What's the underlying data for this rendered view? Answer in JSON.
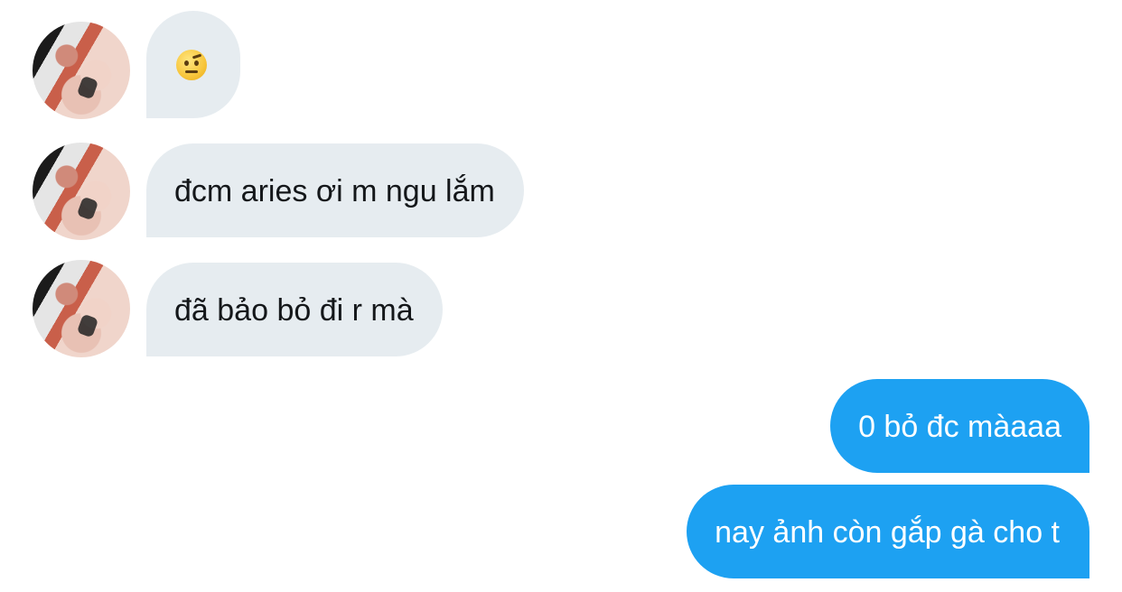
{
  "conversation": {
    "incoming": [
      {
        "type": "emoji",
        "emoji": "🤨",
        "icon": "raised-eyebrow-face-icon"
      },
      {
        "type": "text",
        "text": "đcm aries ơi m ngu lắm"
      },
      {
        "type": "text",
        "text": "đã bảo bỏ đi r mà"
      }
    ],
    "outgoing": [
      {
        "type": "text",
        "text": "0 bỏ đc màaaa"
      },
      {
        "type": "text",
        "text": "nay ảnh còn gắp gà cho t"
      }
    ]
  },
  "colors": {
    "incoming_bubble": "#e6ecf0",
    "incoming_text": "#14171a",
    "outgoing_bubble": "#1da1f2",
    "outgoing_text": "#ffffff"
  }
}
